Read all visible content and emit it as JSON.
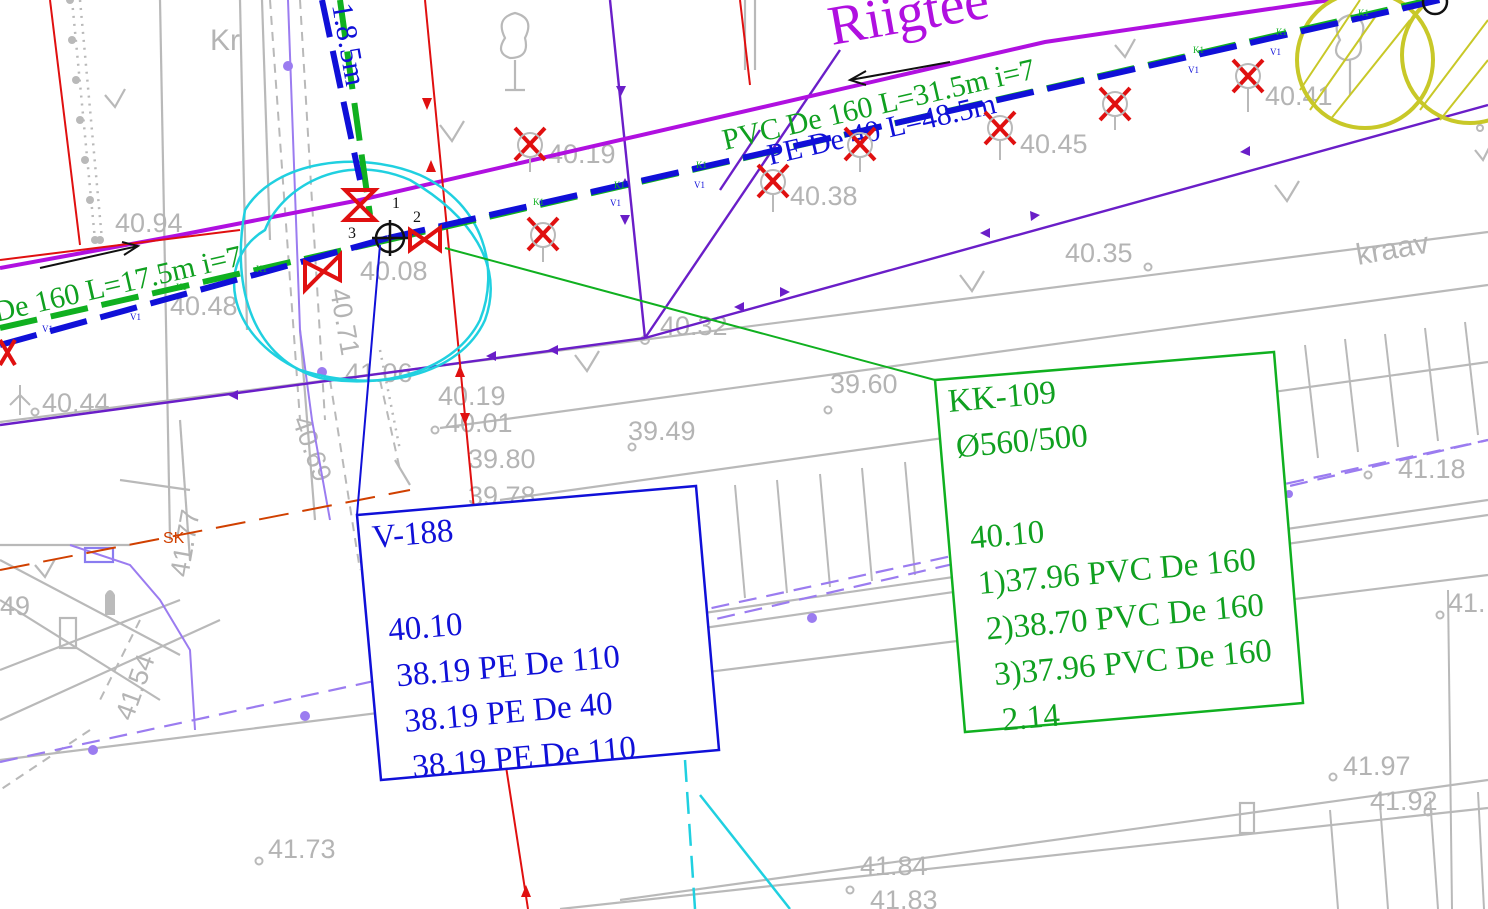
{
  "colors": {
    "background": "#ffffff",
    "grey": "#b4b4b4",
    "water_blue": "#1010d8",
    "sewer_green": "#10b020",
    "magenta": "#b010e0",
    "violet": "#6a1ec8",
    "red": "#e01010",
    "cyan": "#20d0e0",
    "olive": "#c8c828",
    "orange": "#d04000",
    "lavender": "#9b7cf0"
  },
  "street": {
    "name": "Riigitee",
    "name_partial": "Riigtee"
  },
  "map_labels": {
    "kr": "Kr",
    "kraav": "kraav",
    "sk": "SK",
    "pipe_left": "PVC De 160 L=17.5m i=7",
    "pipe_left_visible": "De 160 L=17.5m i=7",
    "pipe_right_pvc": "PVC De 160 L=31.5m i=7",
    "pipe_right_pe": "PE De 40 L=48.5m",
    "pipe_vertical": "1.8.5m",
    "line_tag_k1": "K1",
    "line_tag_v1": "V1",
    "node_1": "1",
    "node_2": "2",
    "node_3": "3"
  },
  "elevations": [
    "40.94",
    "40.19",
    "40.38",
    "40.45",
    "40.41",
    "40.35",
    "40.48",
    "40.08",
    "40.32",
    "40.44",
    "40.71",
    "41.06",
    "40.19",
    "40.01",
    "39.80",
    "39.78",
    "39.49",
    "39.60",
    "40.69",
    "41.54",
    "41.77",
    "41.18",
    "41.97",
    "41.92",
    "41.73",
    "41.84",
    "41.83",
    "41.",
    "49"
  ],
  "callouts": {
    "v188": {
      "id": "V-188",
      "top": "40.10",
      "lines": [
        "38.19 PE De 110",
        "38.19 PE De 40",
        "38.19 PE De 110"
      ]
    },
    "kk109": {
      "id": "KK-109",
      "diameter": "Ø560/500",
      "top": "40.10",
      "lines": [
        "1)37.96 PVC De 160",
        "2)38.70 PVC De 160",
        "3)37.96 PVC De 160"
      ],
      "depth": "2.14"
    }
  }
}
